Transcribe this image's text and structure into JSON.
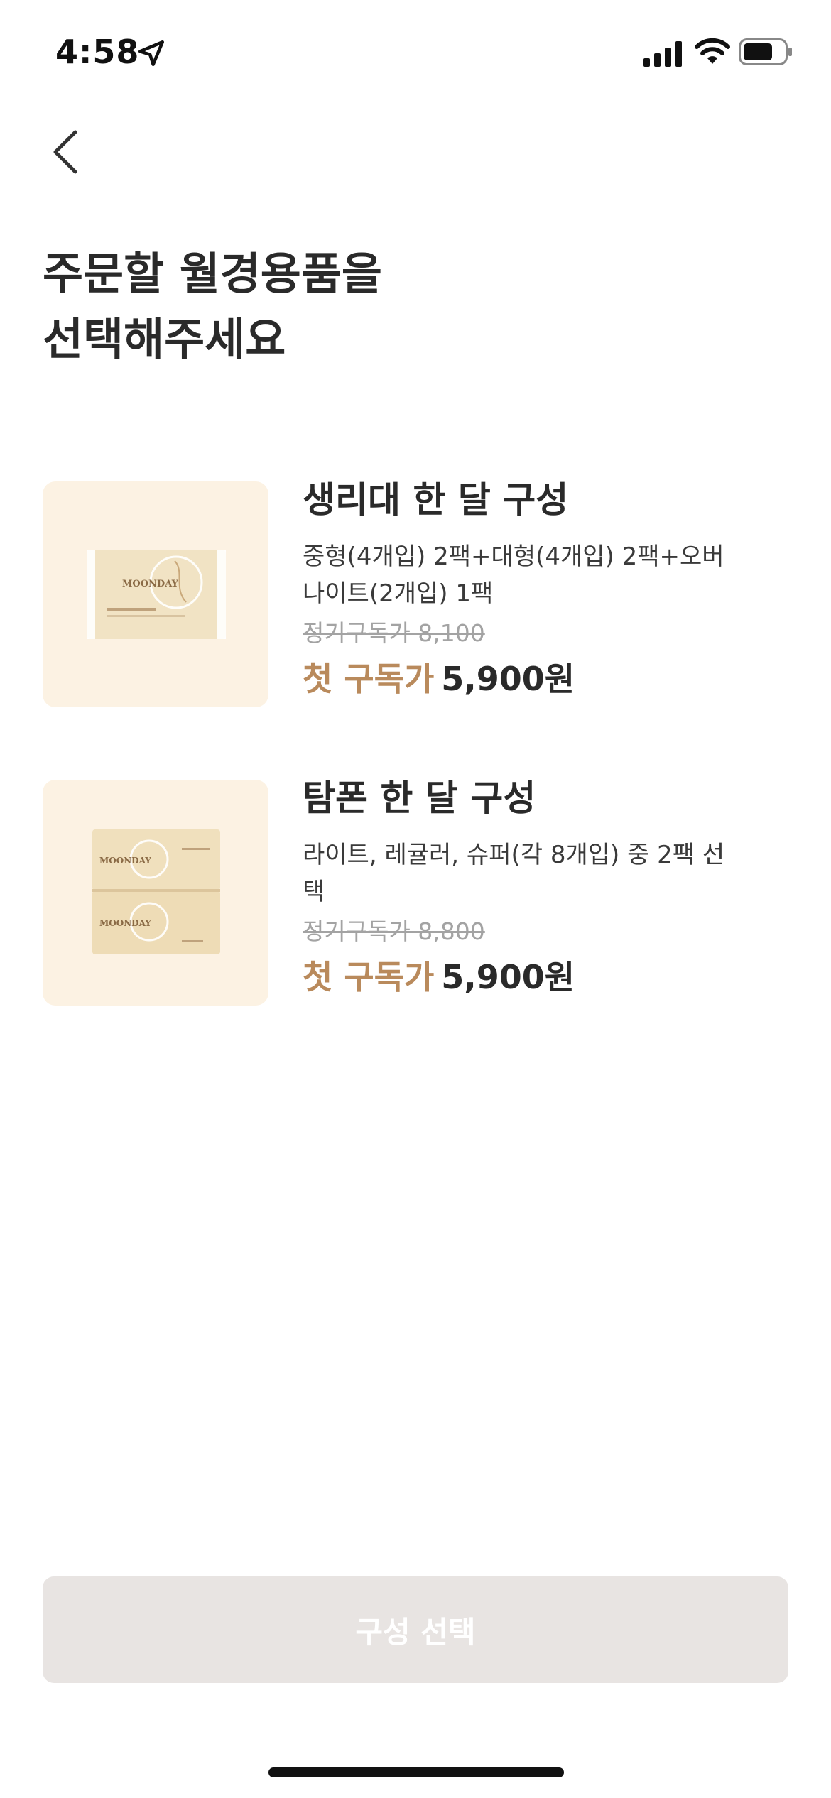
{
  "status_bar": {
    "time": "4:58"
  },
  "header": {
    "title_line1": "주문할 월경용품을",
    "title_line2": "선택해주세요"
  },
  "products": [
    {
      "name": "생리대 한 달 구성",
      "description": "중형(4개입) 2팩+대형(4개입) 2팩+오버나이트(2개입) 1팩",
      "regular_price": "정기구독가 8,100",
      "first_label": "첫 구독가",
      "first_price": "5,900원",
      "image_brand": "MOONDAY"
    },
    {
      "name": "탐폰 한 달 구성",
      "description": "라이트, 레귤러, 슈퍼(각 8개입) 중 2팩 선택",
      "regular_price": "정기구독가 8,800",
      "first_label": "첫 구독가",
      "first_price": "5,900원",
      "image_brand": "MOONDAY"
    }
  ],
  "footer": {
    "select_label": "구성 선택"
  },
  "colors": {
    "accent": "#b98a5c",
    "thumb_bg": "#fcf2e3",
    "button_disabled": "#e8e4e2"
  }
}
